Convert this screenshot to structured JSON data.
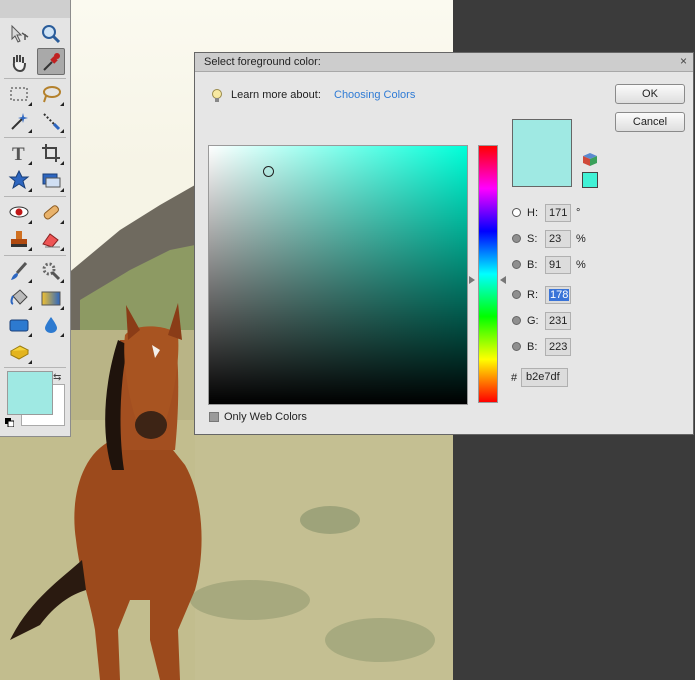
{
  "dialog": {
    "title": "Select foreground color:",
    "close_glyph": "×",
    "learn_prefix": "Learn more about:",
    "learn_link": "Choosing Colors",
    "ok_label": "OK",
    "cancel_label": "Cancel",
    "only_web_colors": "Only Web Colors",
    "hsb": [
      {
        "label": "H:",
        "value": "171",
        "unit": "°",
        "selected": true
      },
      {
        "label": "S:",
        "value": "23",
        "unit": "%",
        "selected": false
      },
      {
        "label": "B:",
        "value": "91",
        "unit": "%",
        "selected": false
      }
    ],
    "rgb": [
      {
        "label": "R:",
        "value": "178",
        "highlighted": true
      },
      {
        "label": "G:",
        "value": "231"
      },
      {
        "label": "B:",
        "value": "223"
      }
    ],
    "hex_label": "#",
    "hex_value": "b2e7df",
    "current_color": "#9fe9e3",
    "websafe_color": "#40f2d6"
  },
  "toolbox": {
    "tools": [
      "move-tool",
      "zoom-tool",
      "hand-tool",
      "eyedropper-tool",
      "rectangular-marquee-tool",
      "lasso-tool",
      "magic-wand-tool",
      "selection-brush-tool",
      "type-tool",
      "crop-tool",
      "cookie-cutter-tool",
      "straighten-tool",
      "red-eye-tool",
      "spot-healing-tool",
      "clone-stamp-tool",
      "eraser-tool",
      "brush-tool",
      "smart-brush-tool",
      "paint-bucket-tool",
      "gradient-tool",
      "shape-tool",
      "blur-tool",
      "sponge-tool"
    ],
    "foreground_color": "#9fe9e3",
    "background_color": "#ffffff"
  }
}
